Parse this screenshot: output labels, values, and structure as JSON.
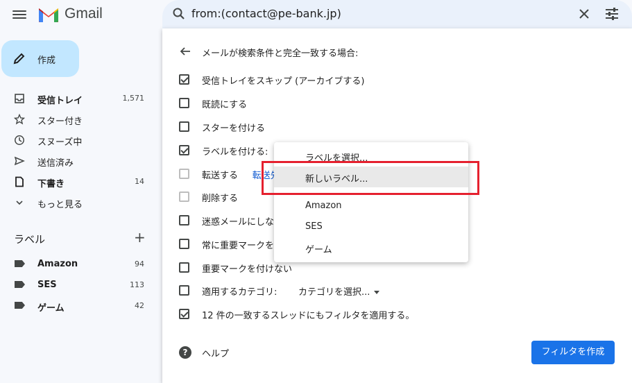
{
  "header": {
    "brand": "Gmail",
    "search_query": "from:(contact@pe-bank.jp)"
  },
  "sidebar": {
    "compose_label": "作成",
    "items": [
      {
        "label": "受信トレイ",
        "count": "1,571",
        "icon": "inbox-icon",
        "bold": true
      },
      {
        "label": "スター付き",
        "count": "",
        "icon": "star-icon",
        "bold": false
      },
      {
        "label": "スヌーズ中",
        "count": "",
        "icon": "clock-icon",
        "bold": false
      },
      {
        "label": "送信済み",
        "count": "",
        "icon": "send-icon",
        "bold": false
      },
      {
        "label": "下書き",
        "count": "14",
        "icon": "draft-icon",
        "bold": true
      },
      {
        "label": "もっと見る",
        "count": "",
        "icon": "chevron-down-icon",
        "bold": false
      }
    ],
    "labels_heading": "ラベル",
    "labels": [
      {
        "label": "Amazon",
        "count": "94"
      },
      {
        "label": "SES",
        "count": "113"
      },
      {
        "label": "ゲーム",
        "count": "42"
      }
    ]
  },
  "filter": {
    "title": "メールが検索条件と完全一致する場合:",
    "options": [
      {
        "label": "受信トレイをスキップ (アーカイブする)",
        "checked": true
      },
      {
        "label": "既読にする",
        "checked": false
      },
      {
        "label": "スターを付ける",
        "checked": false
      },
      {
        "label": "ラベルを付ける:",
        "checked": true
      },
      {
        "label": "転送する",
        "link": "転送先",
        "checked": false,
        "disabled": true
      },
      {
        "label": "削除する",
        "checked": false,
        "disabled": true
      },
      {
        "label": "迷惑メールにしない",
        "checked": false
      },
      {
        "label": "常に重要マークを付ける",
        "checked": false
      },
      {
        "label": "重要マークを付けない",
        "checked": false
      },
      {
        "label": "適用するカテゴリ:",
        "select": "カテゴリを選択...",
        "checked": false
      },
      {
        "label": "12 件の一致するスレッドにもフィルタを適用する。",
        "bold_prefix": "12",
        "checked": true
      }
    ],
    "help_label": "ヘルプ",
    "create_button": "フィルタを作成"
  },
  "dropdown": {
    "items": [
      {
        "label": "ラベルを選択..."
      },
      {
        "label": "新しいラベル..."
      },
      {
        "label": "Amazon"
      },
      {
        "label": "SES"
      },
      {
        "label": "ゲーム"
      }
    ],
    "highlight_color": "#e5202e"
  },
  "colors": {
    "accent": "#1a73e8",
    "compose_bg": "#c2e7ff",
    "search_bg": "#eaf1fb"
  }
}
